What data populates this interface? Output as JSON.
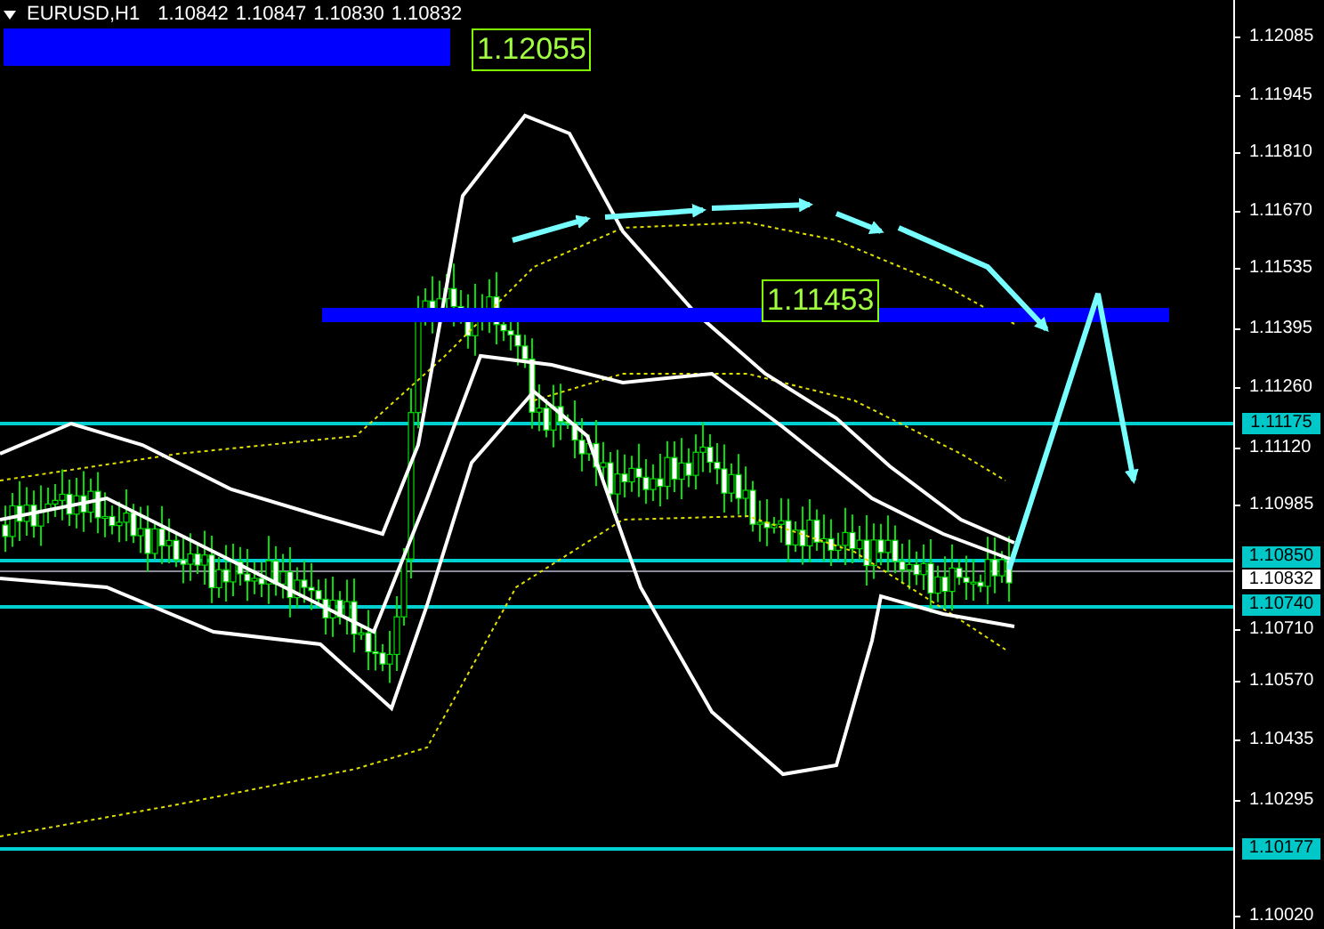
{
  "header": {
    "symbol": "EURUSD,H1",
    "quotes": [
      "1.10842",
      "1.10847",
      "1.10830",
      "1.10832"
    ]
  },
  "price_axis": {
    "labels": [
      "1.12085",
      "1.11945",
      "1.11810",
      "1.11670",
      "1.11535",
      "1.11395",
      "1.11260",
      "1.11120",
      "1.10985",
      "1.10710",
      "1.10570",
      "1.10435",
      "1.10295",
      "1.10020"
    ]
  },
  "price_lines": [
    {
      "label": "1.11175"
    },
    {
      "label": "1.10850"
    },
    {
      "label": "1.10740"
    },
    {
      "label": "1.10177"
    }
  ],
  "current_price": "1.10832",
  "levels": [
    {
      "label": "1.12055"
    },
    {
      "label": "1.11453"
    }
  ]
}
